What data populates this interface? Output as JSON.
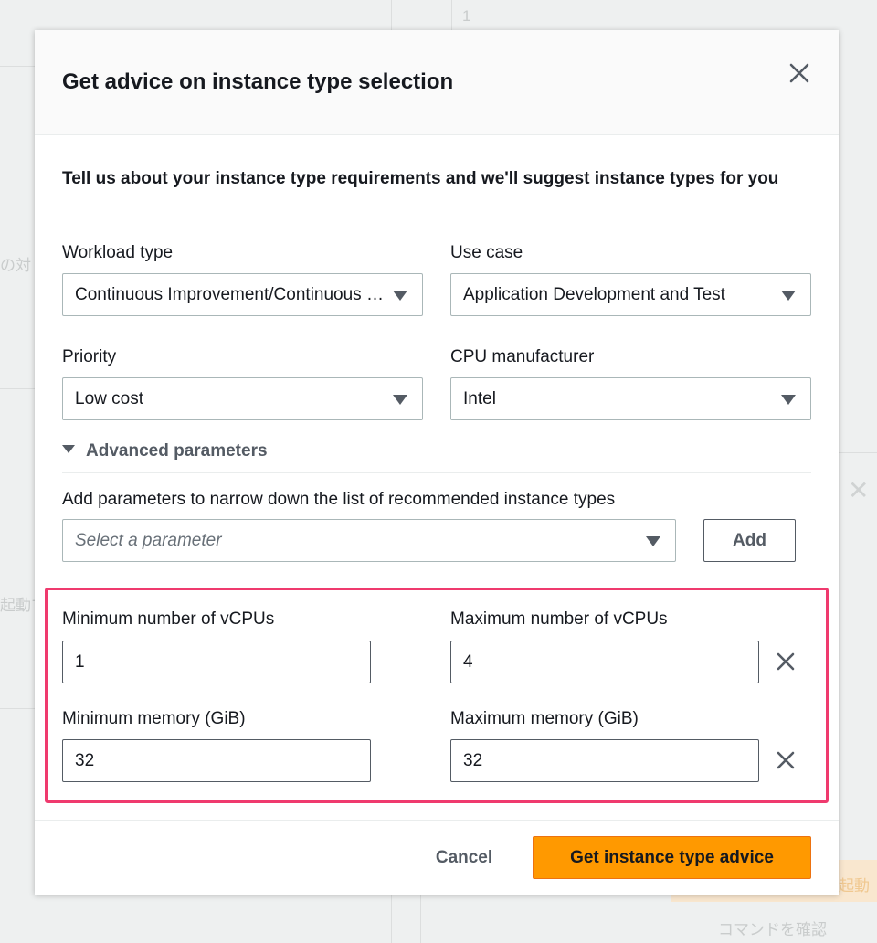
{
  "background": {
    "cell_value": "1",
    "jp_fragment_1": "の対",
    "jp_fragment_2": "起動す",
    "jp_button": "起動",
    "jp_link": "コマンドを確認"
  },
  "modal": {
    "title": "Get advice on instance type selection",
    "close_icon": "close-icon",
    "intro": "Tell us about your instance type requirements and we'll suggest instance types for you",
    "workload": {
      "label": "Workload type",
      "value": "Continuous Improvement/Continuous Delivery"
    },
    "use_case": {
      "label": "Use case",
      "value": "Application Development and Test"
    },
    "priority": {
      "label": "Priority",
      "value": "Low cost"
    },
    "cpu_manufacturer": {
      "label": "CPU manufacturer",
      "value": "Intel"
    },
    "advanced": {
      "toggle_label": "Advanced parameters",
      "expanded": true,
      "description": "Add parameters to narrow down the list of recommended instance types",
      "parameter_select": {
        "placeholder": "Select a parameter"
      },
      "add_label": "Add"
    },
    "parameters": {
      "min_vcpus": {
        "label": "Minimum number of vCPUs",
        "value": "1"
      },
      "max_vcpus": {
        "label": "Maximum number of vCPUs",
        "value": "4"
      },
      "min_memory": {
        "label": "Minimum memory (GiB)",
        "value": "32"
      },
      "max_memory": {
        "label": "Maximum memory (GiB)",
        "value": "32"
      }
    },
    "footer": {
      "cancel_label": "Cancel",
      "submit_label": "Get instance type advice"
    }
  },
  "colors": {
    "accent": "#ff9900",
    "highlight": "#ef3a6e",
    "text": "#16191f",
    "secondary_text": "#545b64"
  }
}
